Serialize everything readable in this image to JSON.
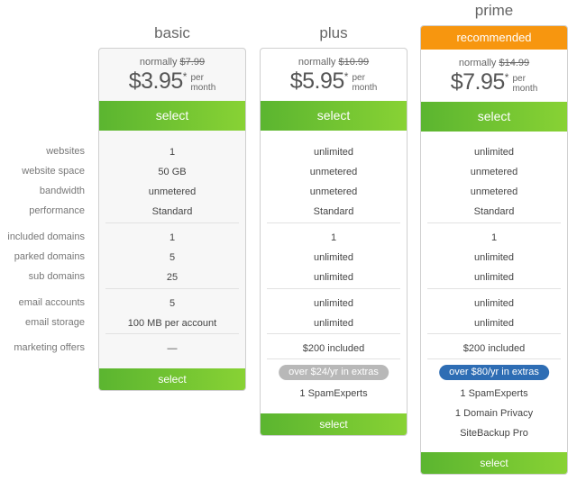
{
  "row_labels": [
    "websites",
    "website space",
    "bandwidth",
    "performance",
    "included domains",
    "parked domains",
    "sub domains",
    "email accounts",
    "email storage",
    "marketing offers"
  ],
  "colors": {
    "select_green_start": "#5bb530",
    "select_green_end": "#88d234",
    "recommended_orange": "#f7960f",
    "extras_gray": "#b8b8b8",
    "extras_blue": "#2e6db4"
  },
  "plans": [
    {
      "name": "basic",
      "normally_label": "normally",
      "old_price": "$7.99",
      "price": "$3.95",
      "asterisk": "*",
      "per": "per",
      "month": "month",
      "select_label": "select",
      "values": [
        "1",
        "50 GB",
        "unmetered",
        "Standard",
        "1",
        "5",
        "25",
        "5",
        "100 MB per account",
        "—"
      ],
      "bottom_select_label": "select"
    },
    {
      "name": "plus",
      "normally_label": "normally",
      "old_price": "$10.99",
      "price": "$5.95",
      "asterisk": "*",
      "per": "per",
      "month": "month",
      "select_label": "select",
      "values": [
        "unlimited",
        "unmetered",
        "unmetered",
        "Standard",
        "1",
        "unlimited",
        "unlimited",
        "unlimited",
        "unlimited",
        "$200 included"
      ],
      "extras_badge": "over $24/yr in extras",
      "extras": [
        "1 SpamExperts"
      ],
      "bottom_select_label": "select"
    },
    {
      "name": "prime",
      "recommended_label": "recommended",
      "normally_label": "normally",
      "old_price": "$14.99",
      "price": "$7.95",
      "asterisk": "*",
      "per": "per",
      "month": "month",
      "select_label": "select",
      "values": [
        "unlimited",
        "unmetered",
        "unmetered",
        "Standard",
        "1",
        "unlimited",
        "unlimited",
        "unlimited",
        "unlimited",
        "$200 included"
      ],
      "extras_badge": "over $80/yr in extras",
      "extras": [
        "1 SpamExperts",
        "1 Domain Privacy",
        "SiteBackup Pro"
      ],
      "bottom_select_label": "select"
    }
  ]
}
